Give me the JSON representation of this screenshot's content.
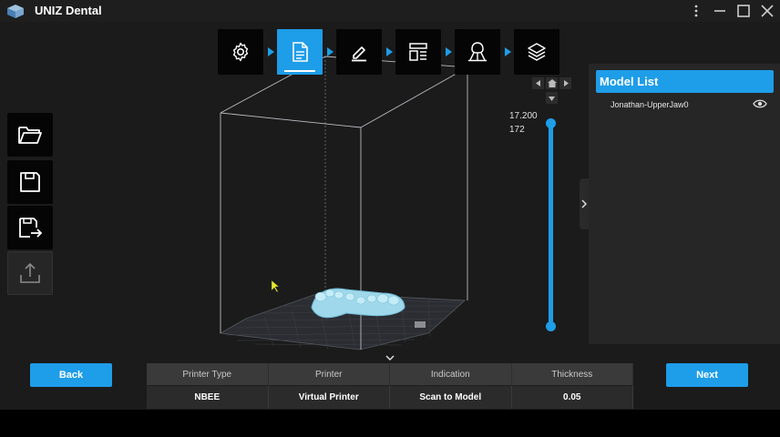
{
  "app": {
    "title": "UNIZ Dental"
  },
  "steps": [
    {
      "name": "settings",
      "icon": "gear-icon",
      "active": false
    },
    {
      "name": "file",
      "icon": "document-icon",
      "active": true
    },
    {
      "name": "edit",
      "icon": "pencil-icon",
      "active": false
    },
    {
      "name": "layout",
      "icon": "layout-icon",
      "active": false
    },
    {
      "name": "support",
      "icon": "support-icon",
      "active": false
    },
    {
      "name": "slice",
      "icon": "layers-icon",
      "active": false
    }
  ],
  "slider": {
    "top_value": "17.200",
    "layer": "172"
  },
  "model_list": {
    "title": "Model List",
    "items": [
      {
        "name": "Jonathan-UpperJaw0"
      }
    ]
  },
  "buttons": {
    "back": "Back",
    "next": "Next"
  },
  "info_table": {
    "headers": [
      "Printer Type",
      "Printer",
      "Indication",
      "Thickness"
    ],
    "values": [
      "NBEE",
      "Virtual Printer",
      "Scan to Model",
      "0.05"
    ]
  },
  "colors": {
    "accent": "#1e9de8",
    "background": "#1b1b1b",
    "panel": "#262626"
  }
}
